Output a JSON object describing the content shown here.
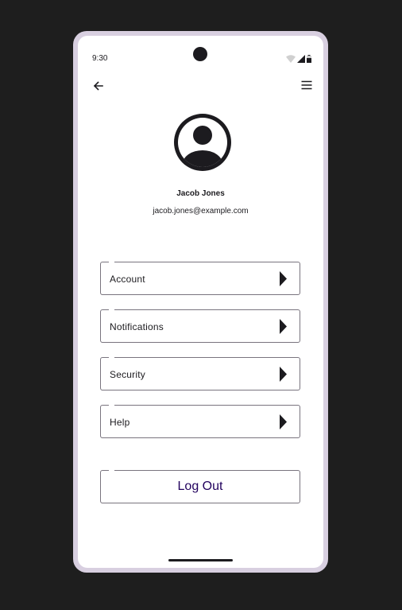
{
  "status_bar": {
    "time": "9:30"
  },
  "app_bar": {
    "back_icon": "arrow-left-icon",
    "menu_icon": "hamburger-menu-icon"
  },
  "profile": {
    "avatar_icon": "account-circle-icon",
    "name": "Jacob Jones",
    "email": "jacob.jones@example.com"
  },
  "menu": {
    "items": [
      {
        "label": "Account",
        "icon": "arrow-right-icon"
      },
      {
        "label": "Notifications",
        "icon": "arrow-right-icon"
      },
      {
        "label": "Security",
        "icon": "arrow-right-icon"
      },
      {
        "label": "Help",
        "icon": "arrow-right-icon"
      }
    ]
  },
  "logout": {
    "label": "Log Out"
  },
  "colors": {
    "accent_text": "#21005d",
    "frame": "#d8cfe0",
    "outline": "#79747e",
    "background": "#1e1e1e"
  }
}
